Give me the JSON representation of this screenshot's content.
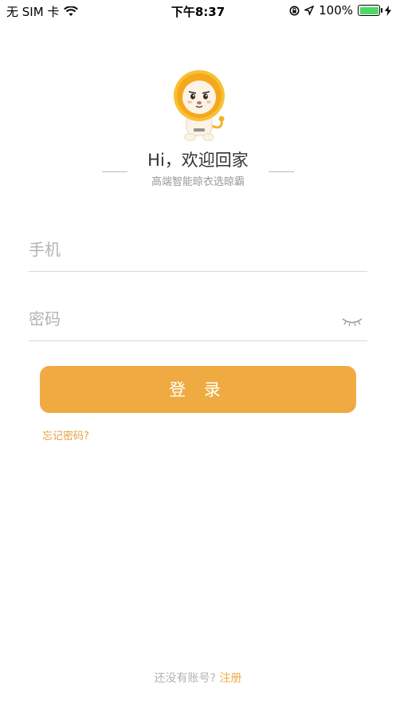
{
  "status_bar": {
    "carrier": "无 SIM 卡",
    "time": "下午8:37",
    "battery": "100%",
    "battery_level": 1.0
  },
  "header": {
    "greeting": "Hi，欢迎回家",
    "subtitle": "高端智能晾衣选晾霸"
  },
  "form": {
    "phone_placeholder": "手机",
    "password_placeholder": "密码",
    "login_label": "登 录",
    "forgot_label": "忘记密码?"
  },
  "footer": {
    "prompt": "还没有账号?",
    "register_label": "注册"
  },
  "colors": {
    "accent": "#efab41",
    "link": "#e6a23c",
    "placeholder": "#b3b3b3"
  },
  "icons": [
    "wifi-icon",
    "rotation-lock-icon",
    "location-icon",
    "battery-icon",
    "charging-icon",
    "mascot-lion-icon",
    "eye-closed-icon"
  ]
}
